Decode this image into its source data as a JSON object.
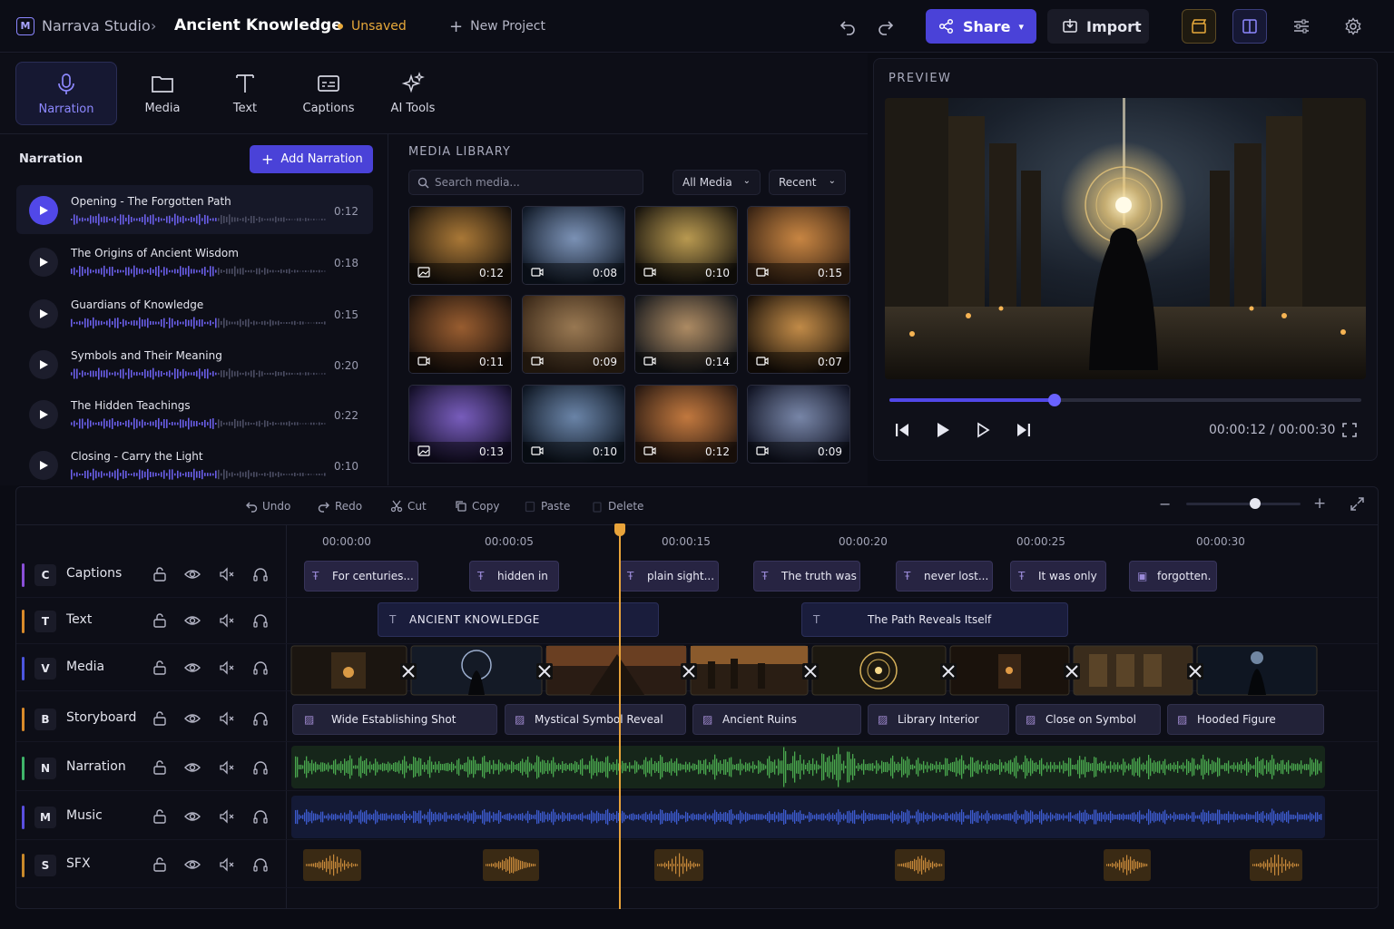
{
  "topbar": {
    "logo_letter": "M",
    "app_name": "Narrava Studio",
    "project_name": "Ancient Knowledge",
    "status": "Unsaved",
    "new_project": "New Project",
    "share": "Share",
    "import": "Import"
  },
  "tools": [
    "Narration",
    "Media",
    "Text",
    "Captions",
    "AI Tools"
  ],
  "narration": {
    "heading": "Narration",
    "add_button": "Add Narration",
    "items": [
      {
        "title": "Opening - The Forgotten Path",
        "duration": "0:12"
      },
      {
        "title": "The Origins of Ancient Wisdom",
        "duration": "0:18"
      },
      {
        "title": "Guardians of Knowledge",
        "duration": "0:15"
      },
      {
        "title": "Symbols and Their Meaning",
        "duration": "0:20"
      },
      {
        "title": "The Hidden Teachings",
        "duration": "0:22"
      },
      {
        "title": "Closing - Carry the Light",
        "duration": "0:10"
      }
    ]
  },
  "media_library": {
    "heading": "MEDIA LIBRARY",
    "search_placeholder": "Search media...",
    "filter": "All Media",
    "sort": "Recent",
    "items": [
      {
        "kind": "image",
        "duration": "0:12"
      },
      {
        "kind": "video",
        "duration": "0:08"
      },
      {
        "kind": "video",
        "duration": "0:10"
      },
      {
        "kind": "video",
        "duration": "0:15"
      },
      {
        "kind": "video",
        "duration": "0:11"
      },
      {
        "kind": "video",
        "duration": "0:09"
      },
      {
        "kind": "video",
        "duration": "0:14"
      },
      {
        "kind": "video",
        "duration": "0:07"
      },
      {
        "kind": "image",
        "duration": "0:13"
      },
      {
        "kind": "video",
        "duration": "0:10"
      },
      {
        "kind": "video",
        "duration": "0:12"
      },
      {
        "kind": "video",
        "duration": "0:09"
      }
    ]
  },
  "preview": {
    "heading": "PREVIEW",
    "time": "00:00:12 / 00:00:30",
    "progress": 0.35
  },
  "edit_toolbar": [
    "Undo",
    "Redo",
    "Cut",
    "Copy",
    "Paste",
    "Delete"
  ],
  "zoom_level": 0.6,
  "ruler": [
    "00:00:00",
    "00:00:05",
    "00:00:15",
    "00:00:20",
    "00:00:25",
    "00:00:30"
  ],
  "tracks": [
    {
      "letter": "C",
      "name": "Captions",
      "color": "#8a4fd8"
    },
    {
      "letter": "T",
      "name": "Text",
      "color": "#d98a2a"
    },
    {
      "letter": "V",
      "name": "Media",
      "color": "#4c56e0"
    },
    {
      "letter": "B",
      "name": "Storyboard",
      "color": "#d98a2a"
    },
    {
      "letter": "N",
      "name": "Narration",
      "color": "#3fb56a"
    },
    {
      "letter": "M",
      "name": "Music",
      "color": "#5a4fe0"
    },
    {
      "letter": "S",
      "name": "SFX",
      "color": "#c9892a"
    }
  ],
  "captions": [
    "For centuries...",
    "hidden in",
    "plain sight...",
    "The truth was",
    "never lost...",
    "It was only",
    "forgotten."
  ],
  "text_clips": [
    "ANCIENT KNOWLEDGE",
    "The Path Reveals Itself"
  ],
  "storyboard": [
    "Wide Establishing Shot",
    "Mystical Symbol Reveal",
    "Ancient Ruins",
    "Library Interior",
    "Close on Symbol",
    "Hooded Figure"
  ],
  "colors": {
    "accent": "#5148e8",
    "playhead": "#e8a33a",
    "narration_wave": "#4aa84e",
    "music_wave": "#3d5bd0",
    "sfx_wave": "#c98a3a"
  }
}
